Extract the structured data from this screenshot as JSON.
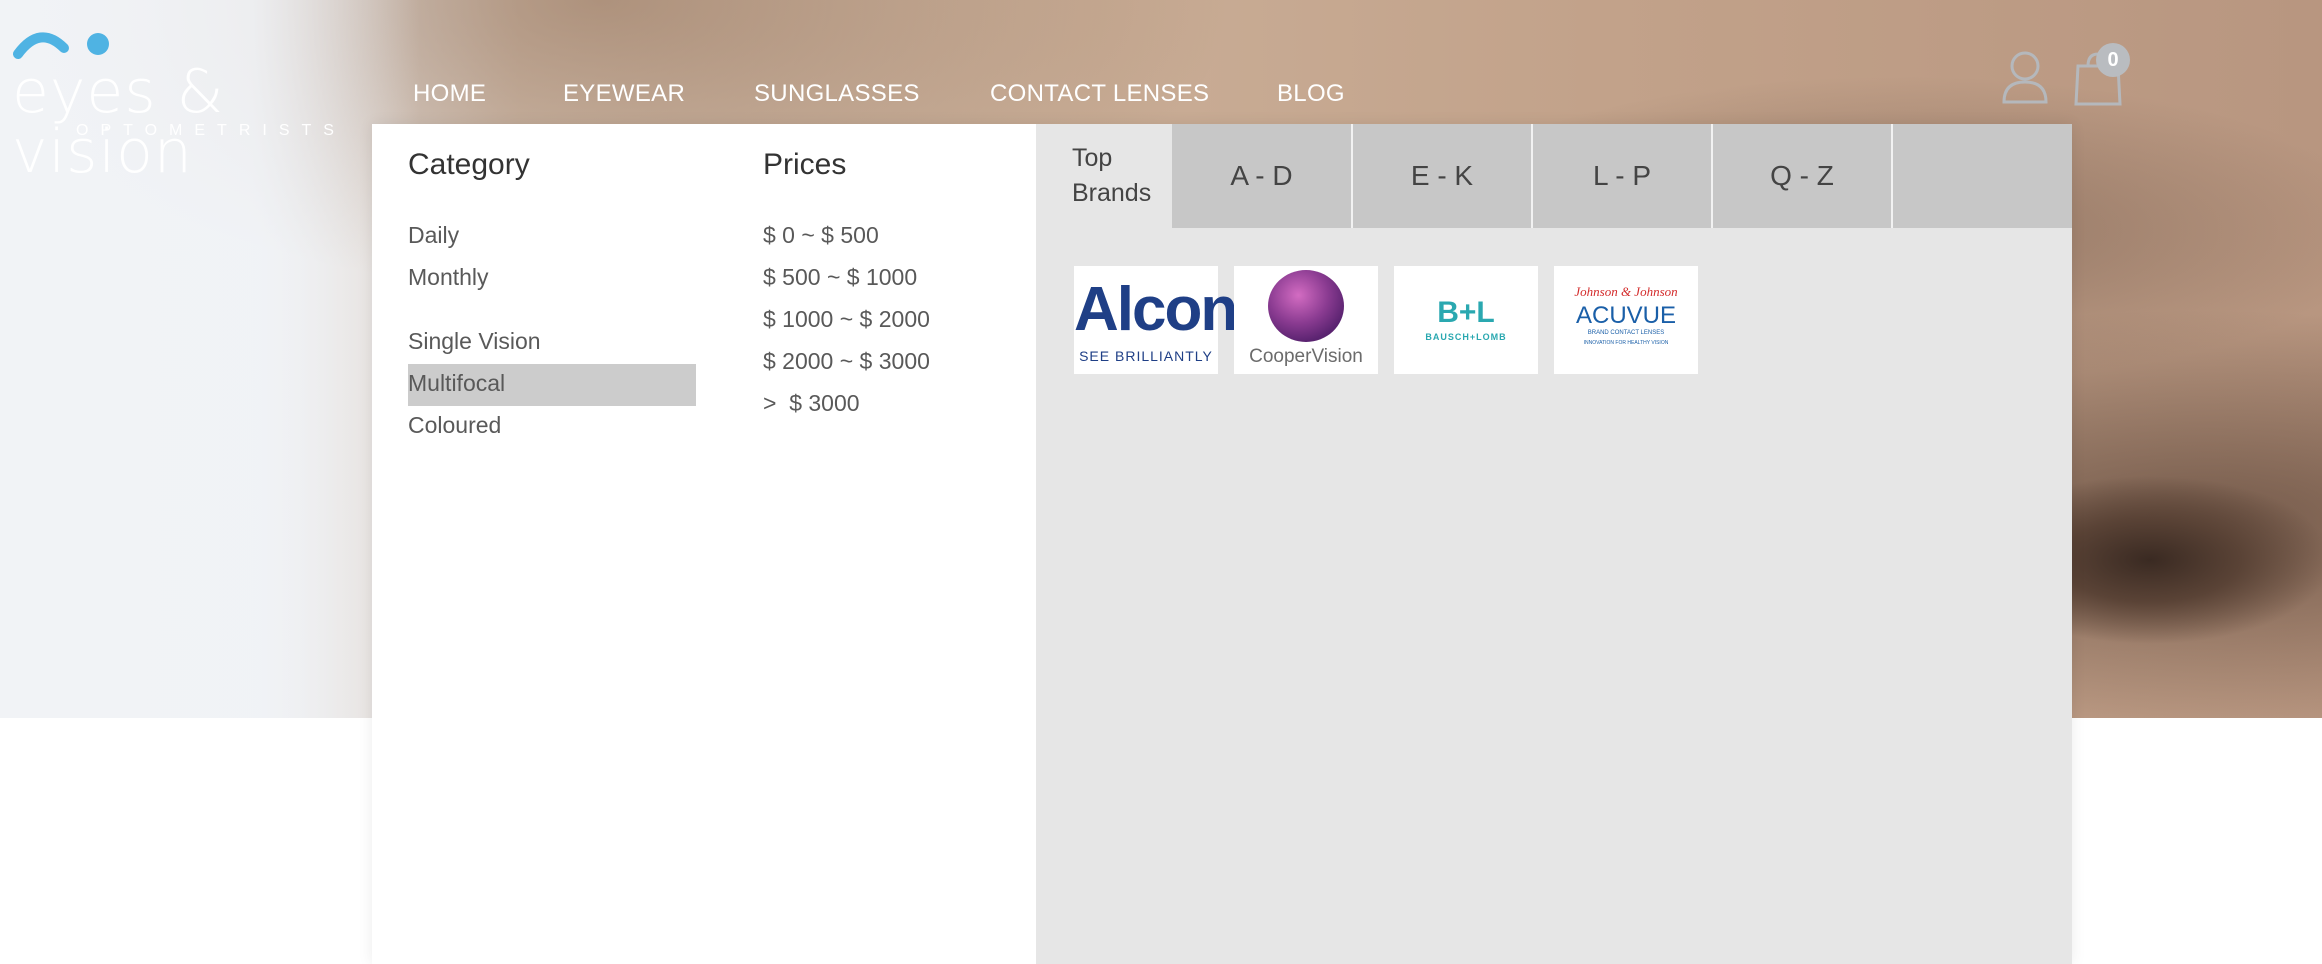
{
  "logo": {
    "main": "eyes & vision",
    "sub": "OPTOMETRISTS",
    "accent": "#4fb3e3"
  },
  "nav": {
    "home": "HOME",
    "eyewear": "EYEWEAR",
    "sunglasses": "SUNGLASSES",
    "contact_lenses": "CONTACT LENSES",
    "blog": "BLOG"
  },
  "header_icons": {
    "account": "user-icon",
    "cart": "shopping-bag-icon",
    "cart_count": "0"
  },
  "menu": {
    "category": {
      "title": "Category",
      "items": [
        "Daily",
        "Monthly",
        "Single Vision",
        "Multifocal",
        "Coloured"
      ],
      "highlighted": "Multifocal"
    },
    "prices": {
      "title": "Prices",
      "items": [
        "$ 0 ~ $ 500",
        "$ 500 ~ $ 1000",
        "$ 1000 ~ $ 2000",
        "$ 2000 ~ $ 3000",
        ">  $ 3000"
      ]
    },
    "brand_tabs": [
      "Top Brands",
      "A - D",
      "E - K",
      "L - P",
      "Q - Z"
    ],
    "brands": [
      {
        "name": "Alcon",
        "tagline": "SEE BRILLIANTLY",
        "color": "#1f3f86"
      },
      {
        "name": "CooperVision",
        "color": "#7a3e8a"
      },
      {
        "name": "B+L",
        "tagline": "BAUSCH+LOMB",
        "color": "#2aa8b0"
      },
      {
        "name": "ACUVUE",
        "maker": "Johnson & Johnson",
        "tagline": "BRAND CONTACT LENSES",
        "note": "INNOVATION FOR HEALTHY VISION",
        "color": "#1a5fa8"
      }
    ]
  }
}
